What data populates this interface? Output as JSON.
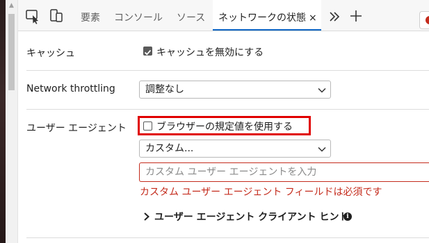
{
  "tabs": [
    {
      "label": "要素"
    },
    {
      "label": "コンソール"
    },
    {
      "label": "ソース"
    },
    {
      "label": "ネットワークの状態"
    }
  ],
  "tab_close_glyph": "×",
  "icons": {
    "inspect": "inspect-element-icon",
    "device": "device-emulation-icon",
    "more": "double-chevron-right-icon",
    "add": "plus-icon",
    "issues": "error-badge-icon"
  },
  "cache": {
    "label": "キャッシュ",
    "checkbox_label": "キャッシュを無効にする",
    "checked": true
  },
  "throttling": {
    "label": "Network throttling",
    "value": "調整なし"
  },
  "user_agent": {
    "label": "ユーザー エージェント",
    "default_checkbox_label": "ブラウザーの規定値を使用する",
    "default_checked": false,
    "preset_value": "カスタム...",
    "input_placeholder": "カスタム ユーザー エージェントを入力",
    "error_message": "カスタム ユーザー エージェント フィールドは必須です",
    "client_hints_label": "ユーザー エージェント クライアント ヒント",
    "info_glyph": "i"
  },
  "colors": {
    "accent": "#0b63c4",
    "error": "#c42b1c",
    "highlight": "#e00000"
  }
}
